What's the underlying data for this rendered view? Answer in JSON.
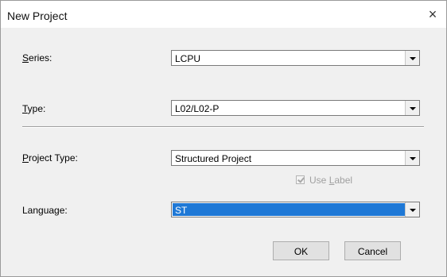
{
  "dialog": {
    "title": "New Project",
    "close_symbol": "×"
  },
  "fields": {
    "series": {
      "label_mnemonic": "S",
      "label_rest": "eries:",
      "value": "LCPU"
    },
    "type": {
      "label_mnemonic": "T",
      "label_rest": "ype:",
      "value": "L02/L02-P"
    },
    "project_type": {
      "label_mnemonic": "P",
      "label_rest": "roject Type:",
      "value": "Structured Project"
    },
    "use_label": {
      "label_pre": "Use ",
      "label_mnemonic": "L",
      "label_post": "abel",
      "checked": true,
      "enabled": false
    },
    "language": {
      "label": "Language:",
      "value": "ST"
    }
  },
  "buttons": {
    "ok": "OK",
    "cancel": "Cancel"
  },
  "colors": {
    "selection": "#1e78d6",
    "dialog_background": "#f0f0f0"
  }
}
